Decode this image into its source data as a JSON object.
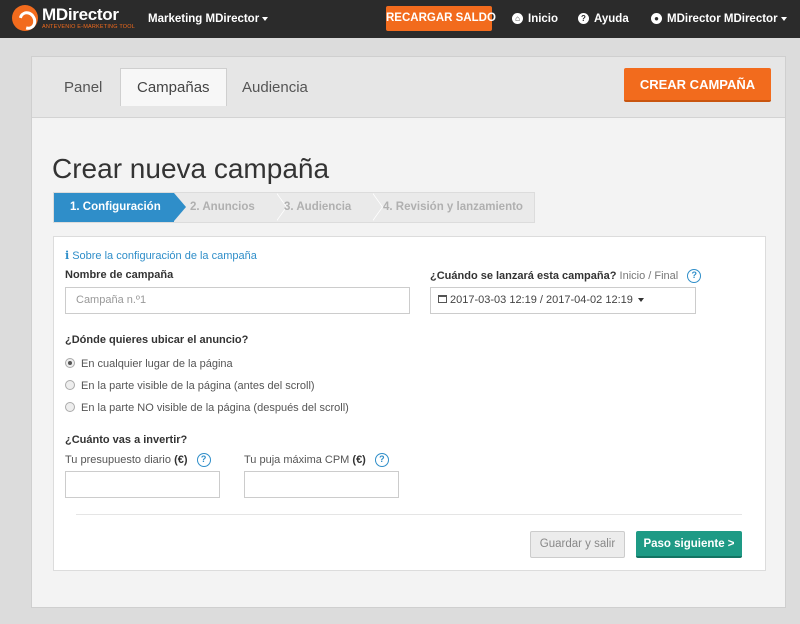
{
  "topbar": {
    "logo_name": "MDirector",
    "logo_sub": "ANTEVENIO E-MARKETING TOOL",
    "product_menu": "Marketing MDirector",
    "recharge_button": "RECARGAR SALDO",
    "home": "Inicio",
    "help": "Ayuda",
    "user": "MDirector MDirector"
  },
  "header": {
    "tabs": [
      {
        "label": "Panel"
      },
      {
        "label": "Campañas"
      },
      {
        "label": "Audiencia"
      }
    ],
    "create_button": "CREAR CAMPAÑA"
  },
  "page": {
    "title": "Crear nueva campaña",
    "steps": [
      {
        "label": "1. Configuración"
      },
      {
        "label": "2. Anuncios"
      },
      {
        "label": "3. Audiencia"
      },
      {
        "label": "4. Revisión y lanzamiento"
      }
    ]
  },
  "form": {
    "info_link": "Sobre la configuración de la campaña",
    "name_label": "Nombre de campaña",
    "name_placeholder": "Campaña n.º1",
    "date_label": "¿Cuándo se lanzará esta campaña?",
    "date_hint": "Inicio / Final",
    "date_value": "2017-03-03 12:19  /  2017-04-02 12:19",
    "placement_label": "¿Dónde quieres ubicar el anuncio?",
    "placement_options": [
      {
        "label": "En cualquier lugar de la página"
      },
      {
        "label": "En la parte visible de la página (antes del scroll)"
      },
      {
        "label": "En la parte NO visible de la página (después del scroll)"
      }
    ],
    "selected_option": 0,
    "invest_label": "¿Cuánto vas a invertir?",
    "budget_label": "Tu presupuesto diario",
    "cpm_label": "Tu puja máxima CPM",
    "currency": "(€)",
    "help_glyph": "?",
    "save_button": "Guardar y salir",
    "next_button": "Paso siguiente >"
  },
  "colors": {
    "accent_orange": "#f26b1d",
    "step_active_blue": "#2f8ec9",
    "next_green": "#1e9a85"
  }
}
